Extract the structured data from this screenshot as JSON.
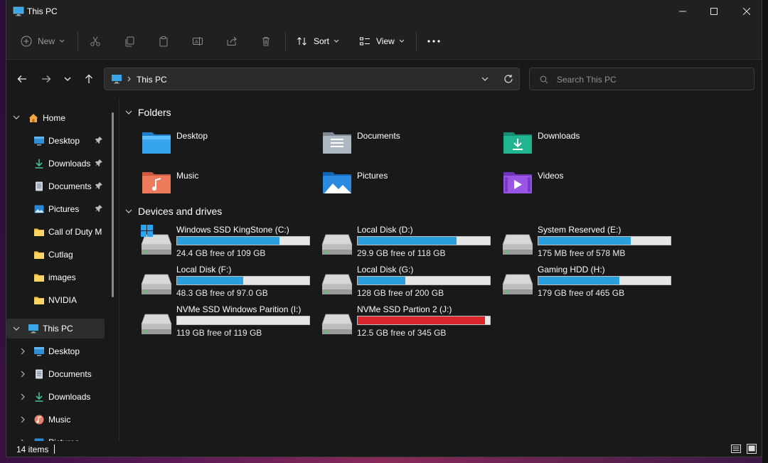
{
  "window": {
    "title": "This PC",
    "icon": "this-pc-icon"
  },
  "toolbar": {
    "new_label": "New",
    "sort_label": "Sort",
    "view_label": "View"
  },
  "address": {
    "path": "This PC"
  },
  "search": {
    "placeholder": "Search This PC"
  },
  "sidebar": {
    "home": "Home",
    "quick_access": [
      {
        "label": "Desktop",
        "icon": "desktop-icon",
        "pinned": true
      },
      {
        "label": "Downloads",
        "icon": "downloads-icon",
        "pinned": true
      },
      {
        "label": "Documents",
        "icon": "documents-icon",
        "pinned": true
      },
      {
        "label": "Pictures",
        "icon": "pictures-icon",
        "pinned": true
      },
      {
        "label": "Call of Duty  M",
        "icon": "folder-icon",
        "pinned": false
      },
      {
        "label": "Cutlag",
        "icon": "folder-icon",
        "pinned": false
      },
      {
        "label": "images",
        "icon": "folder-icon",
        "pinned": false
      },
      {
        "label": "NVIDIA",
        "icon": "folder-icon",
        "pinned": false
      }
    ],
    "this_pc": "This PC",
    "this_pc_children": [
      {
        "label": "Desktop",
        "icon": "desktop-icon"
      },
      {
        "label": "Documents",
        "icon": "documents-icon"
      },
      {
        "label": "Downloads",
        "icon": "downloads-icon"
      },
      {
        "label": "Music",
        "icon": "music-icon"
      },
      {
        "label": "Pictures",
        "icon": "pictures-icon"
      }
    ]
  },
  "content": {
    "folders_title": "Folders",
    "folders": [
      {
        "label": "Desktop",
        "icon": "desktop-folder-icon"
      },
      {
        "label": "Documents",
        "icon": "documents-folder-icon"
      },
      {
        "label": "Downloads",
        "icon": "downloads-folder-icon"
      },
      {
        "label": "Music",
        "icon": "music-folder-icon"
      },
      {
        "label": "Pictures",
        "icon": "pictures-folder-icon"
      },
      {
        "label": "Videos",
        "icon": "videos-folder-icon"
      }
    ],
    "drives_title": "Devices and drives",
    "drives": [
      {
        "name": "Windows SSD KingStone (C:)",
        "free": "24.4 GB free of 109 GB",
        "used_fraction": 0.776,
        "windows": true
      },
      {
        "name": "Local Disk (D:)",
        "free": "29.9 GB free of 118 GB",
        "used_fraction": 0.747,
        "windows": false
      },
      {
        "name": "System Reserved (E:)",
        "free": "175 MB free of 578 MB",
        "used_fraction": 0.697,
        "windows": false
      },
      {
        "name": "Local Disk (F:)",
        "free": "48.3 GB free of 97.0 GB",
        "used_fraction": 0.502,
        "windows": false
      },
      {
        "name": "Local Disk (G:)",
        "free": "128 GB free of 200 GB",
        "used_fraction": 0.36,
        "windows": false
      },
      {
        "name": "Gaming HDD (H:)",
        "free": "179 GB free of 465 GB",
        "used_fraction": 0.615,
        "windows": false
      },
      {
        "name": "NVMe SSD Windows Parition (I:)",
        "free": "119 GB free of 119 GB",
        "used_fraction": 0.0,
        "windows": false
      },
      {
        "name": "NVMe SSD Partion 2 (J:)",
        "free": "12.5 GB free of 345 GB",
        "used_fraction": 0.964,
        "windows": false
      }
    ]
  },
  "status": {
    "items": "14 items"
  },
  "colors": {
    "bar_normal": "#2a9fdc",
    "bar_full": "#d9262c",
    "accent": "#4cc2ff"
  }
}
